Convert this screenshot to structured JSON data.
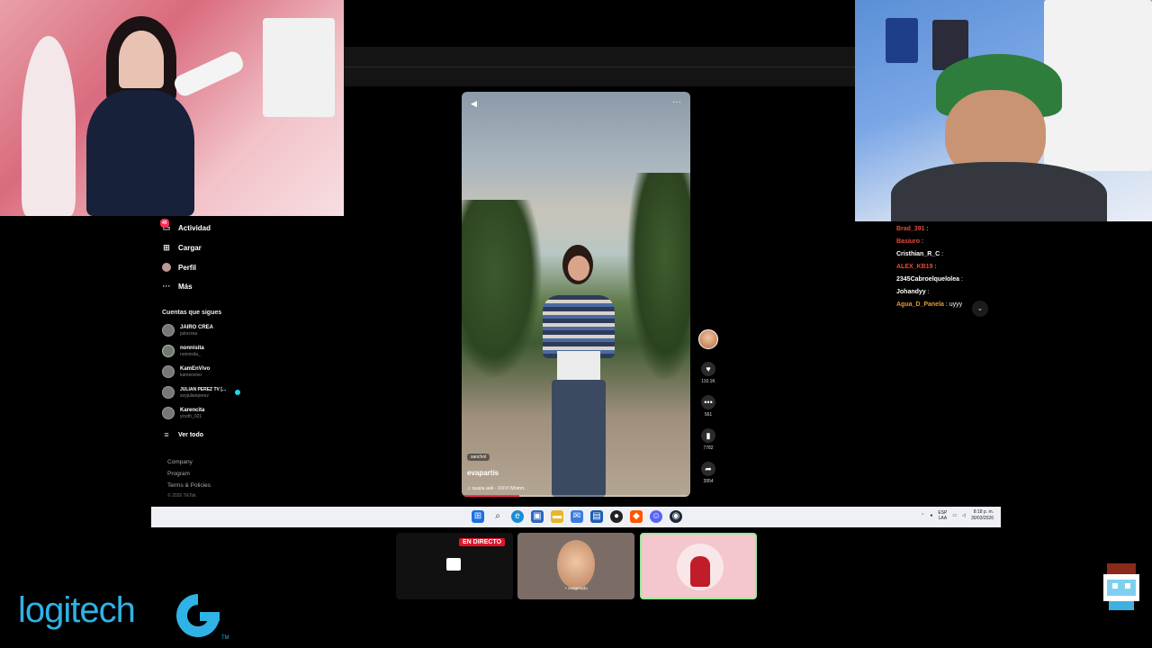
{
  "sidebar": {
    "nav": [
      {
        "label": "Actividad",
        "icon": "activity-icon",
        "badge": "40"
      },
      {
        "label": "Cargar",
        "icon": "upload-icon"
      },
      {
        "label": "Perfil",
        "icon": "profile-icon"
      },
      {
        "label": "Más",
        "icon": "more-icon"
      }
    ],
    "following_title": "Cuentas que sigues",
    "following": [
      {
        "name": "JAIRO CREA",
        "handle": "jairocrea"
      },
      {
        "name": "nonnisita",
        "handle": "nonnisita_"
      },
      {
        "name": "KamEnVivo",
        "handle": "kamenvivo"
      },
      {
        "name": "JULIAN PEREZ TV [...",
        "handle": "soyjulianperez"
      },
      {
        "name": "Karencita",
        "handle": "yiceth_021"
      }
    ],
    "see_all": "Ver todo",
    "footer": [
      "Company",
      "Program",
      "Terms & Policies",
      "© 2026 TikTok"
    ]
  },
  "video": {
    "tag": "sanchol",
    "author": "evapartis",
    "music": "suara asli - XXVI Moinn.",
    "progress": 0.25
  },
  "actions": [
    {
      "icon": "heart-icon",
      "count": "110.1K"
    },
    {
      "icon": "comment-icon",
      "count": "561"
    },
    {
      "icon": "bookmark-icon",
      "count": "7782"
    },
    {
      "icon": "share-icon",
      "count": "3954"
    }
  ],
  "chat": [
    {
      "user": "Brad_391",
      "text": "",
      "color": "#e74c3c"
    },
    {
      "user": "Basiuro",
      "text": "",
      "color": "#e74c3c"
    },
    {
      "user": "Cristhian_R_C",
      "text": "",
      "color": "#ffffff"
    },
    {
      "user": "ALEX_KB19",
      "text": "",
      "color": "#e74c3c"
    },
    {
      "user": "2345Cabroelquelolea",
      "text": "",
      "color": "#ffffff"
    },
    {
      "user": "Johandyy",
      "text": "",
      "color": "#ffffff"
    },
    {
      "user": "Agua_D_Panela",
      "text": "uyyy",
      "color": "#e69a3a"
    }
  ],
  "taskbar": {
    "lang_top": "ESP",
    "lang_bottom": "LAA",
    "time": "8:18 p. m.",
    "date": "30/03/2026"
  },
  "live_label": "EN DIRECTO",
  "thumb_caption": "+ exagerado",
  "logo_text": "logitech",
  "logo_tm": "TM",
  "colors": {
    "accent": "#fe2c55",
    "logo": "#2fb2e6",
    "live": "#e0162b"
  }
}
